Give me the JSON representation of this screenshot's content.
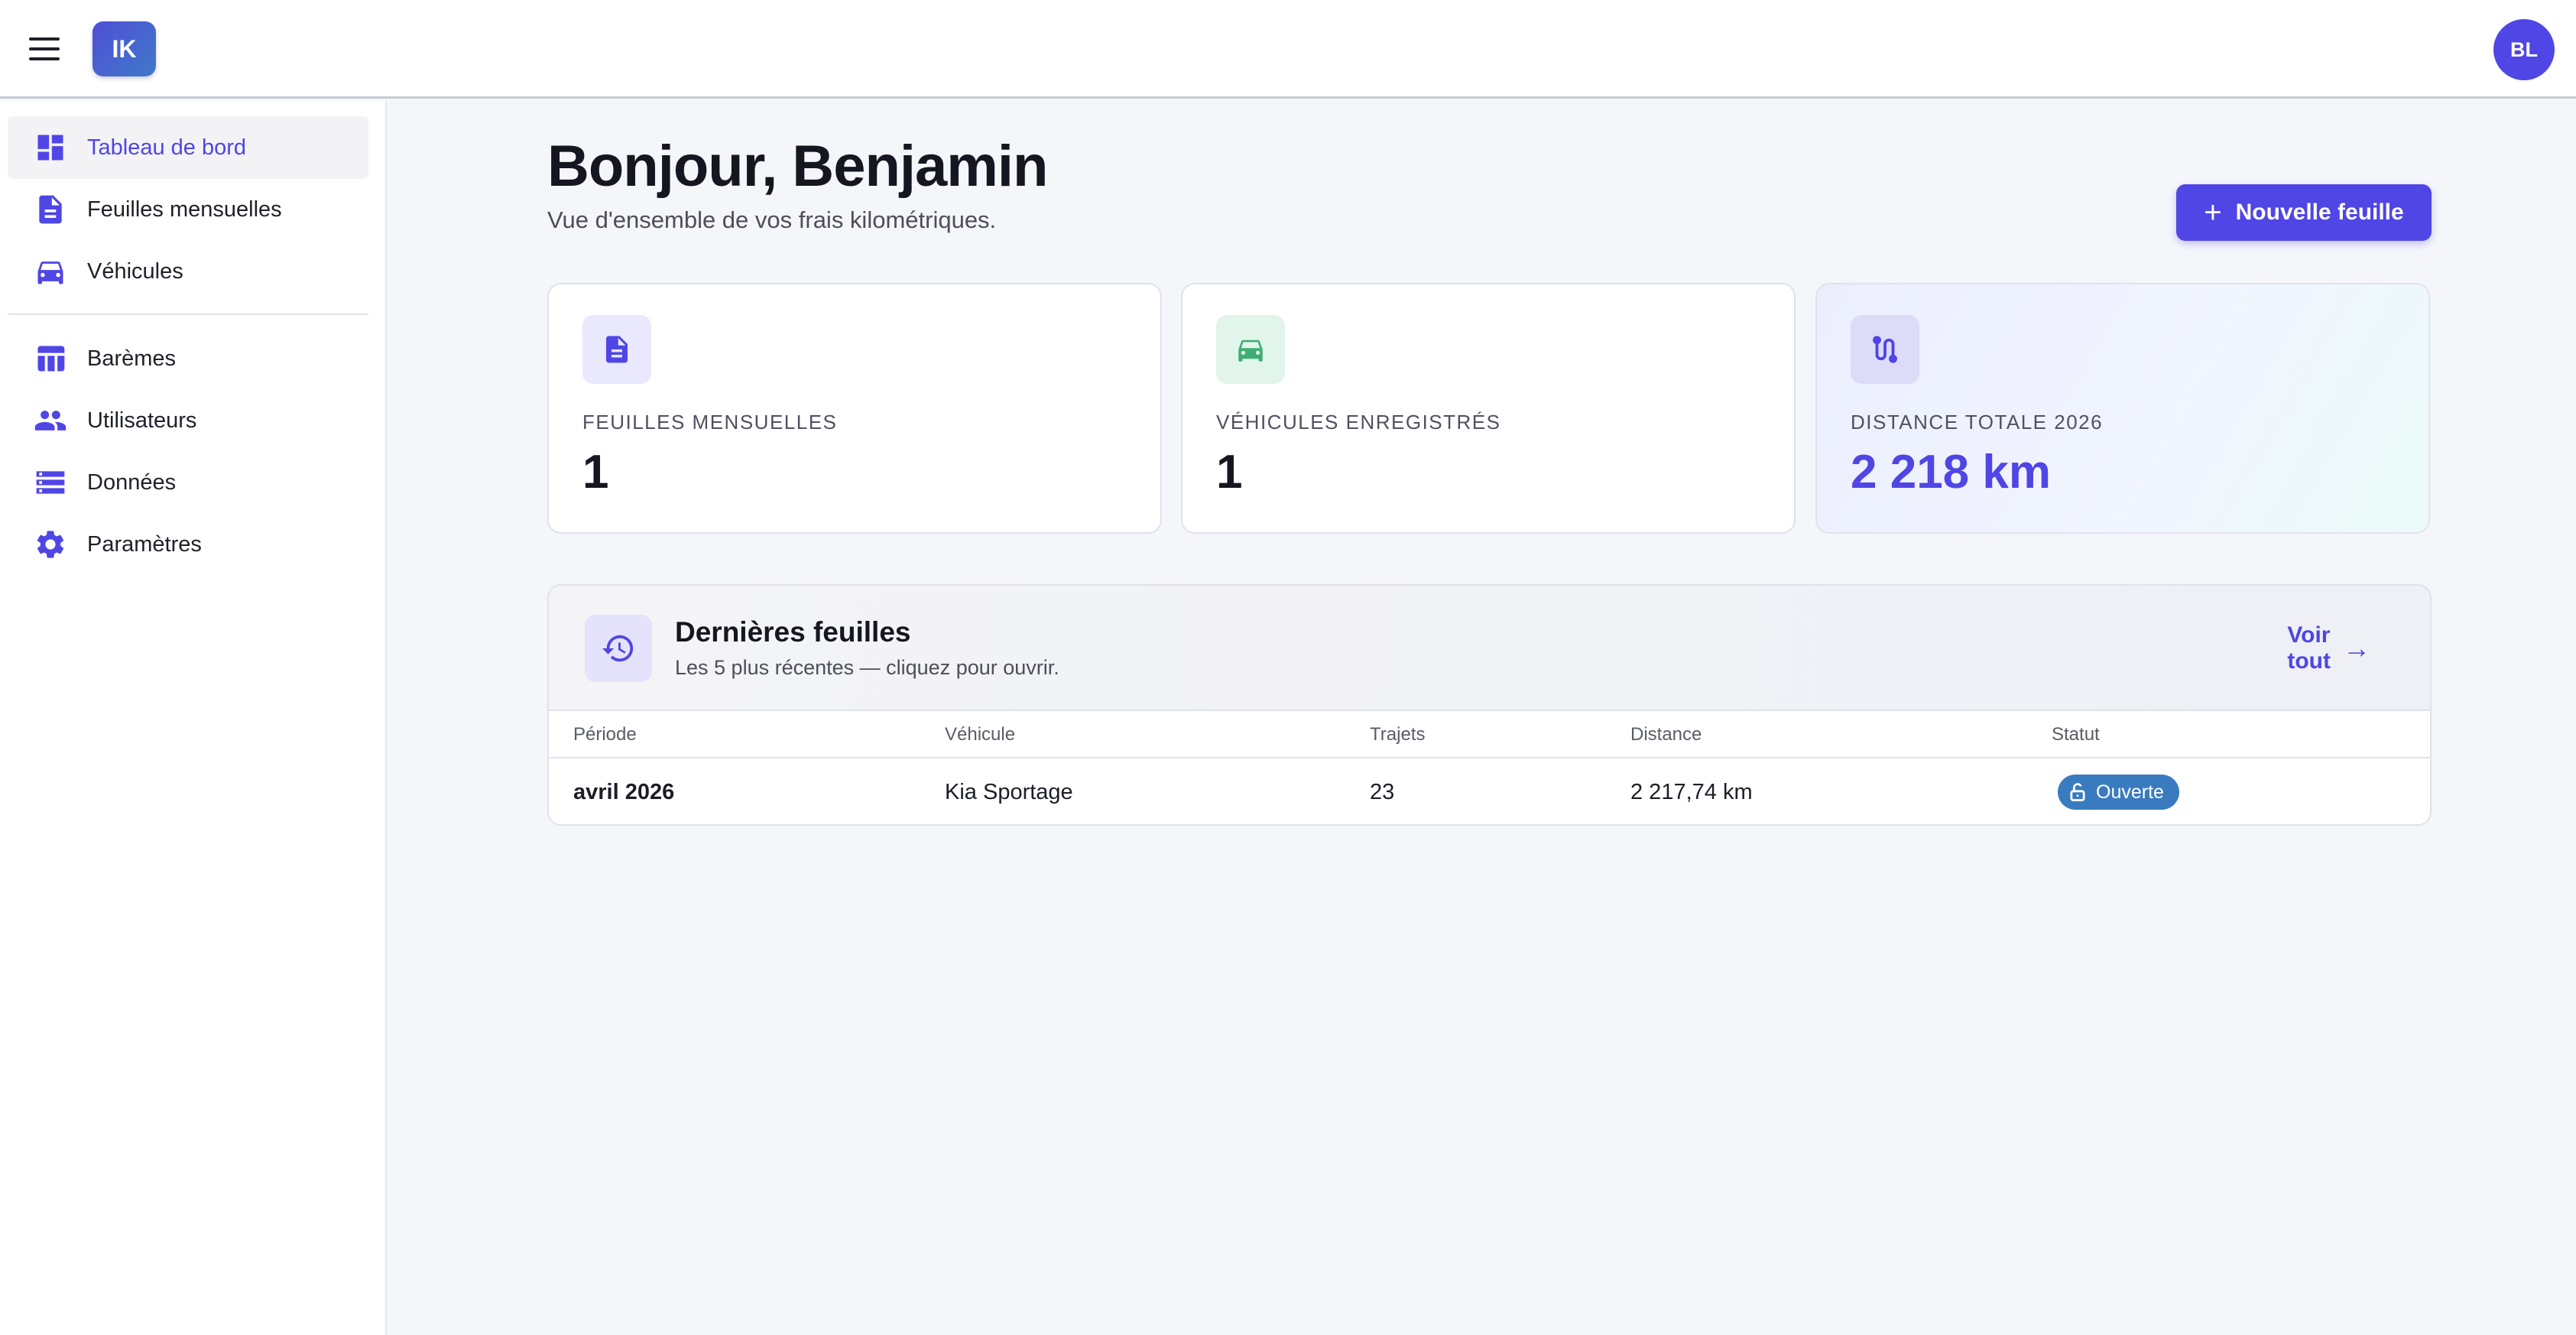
{
  "topbar": {
    "menu_icon": "hamburger-menu-icon",
    "logo": "IK",
    "avatar_initials": "BL"
  },
  "sidebar": {
    "items": [
      {
        "label": "Tableau de bord",
        "icon": "dashboard-icon",
        "active": true
      },
      {
        "label": "Feuilles mensuelles",
        "icon": "document-icon"
      },
      {
        "label": "Véhicules",
        "icon": "car-icon"
      },
      {
        "label": "Barèmes",
        "icon": "table-icon"
      },
      {
        "label": "Utilisateurs",
        "icon": "people-icon"
      },
      {
        "label": "Données",
        "icon": "list-icon"
      },
      {
        "label": "Paramètres",
        "icon": "gear-icon"
      }
    ]
  },
  "main": {
    "greeting": "Bonjour, Benjamin",
    "subtitle": "Vue d'ensemble de vos frais kilométriques.",
    "new_button_label": "Nouvelle feuille",
    "stats": [
      {
        "label": "Feuilles mensuelles",
        "value": "1",
        "icon": "document-icon"
      },
      {
        "label": "Véhicules enregistrés",
        "value": "1",
        "icon": "car-icon"
      },
      {
        "label": "Distance totale 2026",
        "value": "2 218 km",
        "icon": "route-icon"
      }
    ],
    "recent": {
      "title": "Dernières feuilles",
      "subtitle": "Les 5 plus récentes — cliquez pour ouvrir.",
      "see_all": "Voir tout",
      "columns": [
        "Période",
        "Véhicule",
        "Trajets",
        "Distance",
        "Statut"
      ],
      "rows": [
        {
          "period": "avril 2026",
          "vehicle": "Kia Sportage",
          "trips": "23",
          "distance": "2 217,74 km",
          "status": "Ouverte"
        }
      ]
    }
  },
  "colors": {
    "accent": "#4f46e5",
    "status_open": "#3a7bbf",
    "vehicle_icon": "#3fae74"
  }
}
